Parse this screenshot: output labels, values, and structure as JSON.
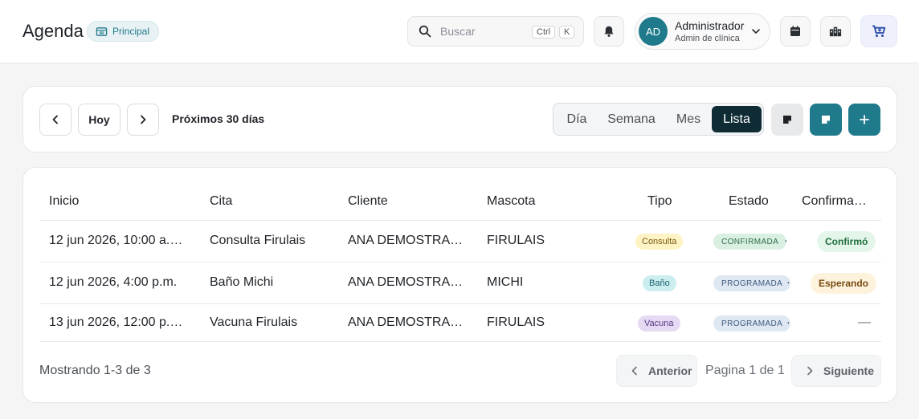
{
  "header": {
    "title": "Agenda",
    "branch": "Principal",
    "search": {
      "placeholder": "Buscar",
      "shortcut_ctrl": "Ctrl",
      "shortcut_key": "K"
    },
    "user": {
      "initials": "AD",
      "name": "Administrador",
      "role": "Admin de clínica"
    }
  },
  "toolbar": {
    "today_label": "Hoy",
    "range_label": "Próximos 30 días",
    "views": [
      "Día",
      "Semana",
      "Mes",
      "Lista"
    ],
    "active_view": "Lista"
  },
  "table": {
    "columns": [
      "Inicio",
      "Cita",
      "Cliente",
      "Mascota",
      "Tipo",
      "Estado",
      "Confirma…"
    ],
    "rows": [
      {
        "inicio": "12 jun 2026, 10:00 a.…",
        "cita": "Consulta Firulais",
        "cliente": "ANA DEMOSTRACI…",
        "mascota": "FIRULAIS",
        "tipo": "Consulta",
        "estado": "CONFIRMADA",
        "confirmacion": "Confirmó"
      },
      {
        "inicio": "12 jun 2026, 4:00 p.m.",
        "cita": "Baño Michi",
        "cliente": "ANA DEMOSTRACI…",
        "mascota": "MICHI",
        "tipo": "Baño",
        "estado": "PROGRAMADA",
        "confirmacion": "Esperando"
      },
      {
        "inicio": "13 jun 2026, 12:00 p.…",
        "cita": "Vacuna Firulais",
        "cliente": "ANA DEMOSTRACI…",
        "mascota": "FIRULAIS",
        "tipo": "Vacuna",
        "estado": "PROGRAMADA",
        "confirmacion": "—"
      }
    ]
  },
  "pagination": {
    "summary": "Mostrando 1-3 de 3",
    "prev_label": "Anterior",
    "page_text": "Pagina 1 de 1",
    "next_label": "Siguiente"
  },
  "colors": {
    "accent": "#1f7a8c",
    "active_view_bg": "#0f2c35",
    "tipo_consulta": "#fdf3c4",
    "tipo_bano": "#cdeef0",
    "tipo_vacuna": "#e6d9f3",
    "estado_confirmada": "#d9efe2",
    "estado_programada": "#dfe8f2",
    "conf_confirmo": "#e4f6ea",
    "conf_esperando": "#fdf3dd"
  },
  "icons": [
    "building-badge-icon",
    "search-icon",
    "bell-icon",
    "chevron-down-icon",
    "calendar-icon",
    "buildings-icon",
    "cart-icon",
    "chevron-left-icon",
    "chevron-right-icon",
    "sticky-note-icon",
    "plus-icon"
  ]
}
